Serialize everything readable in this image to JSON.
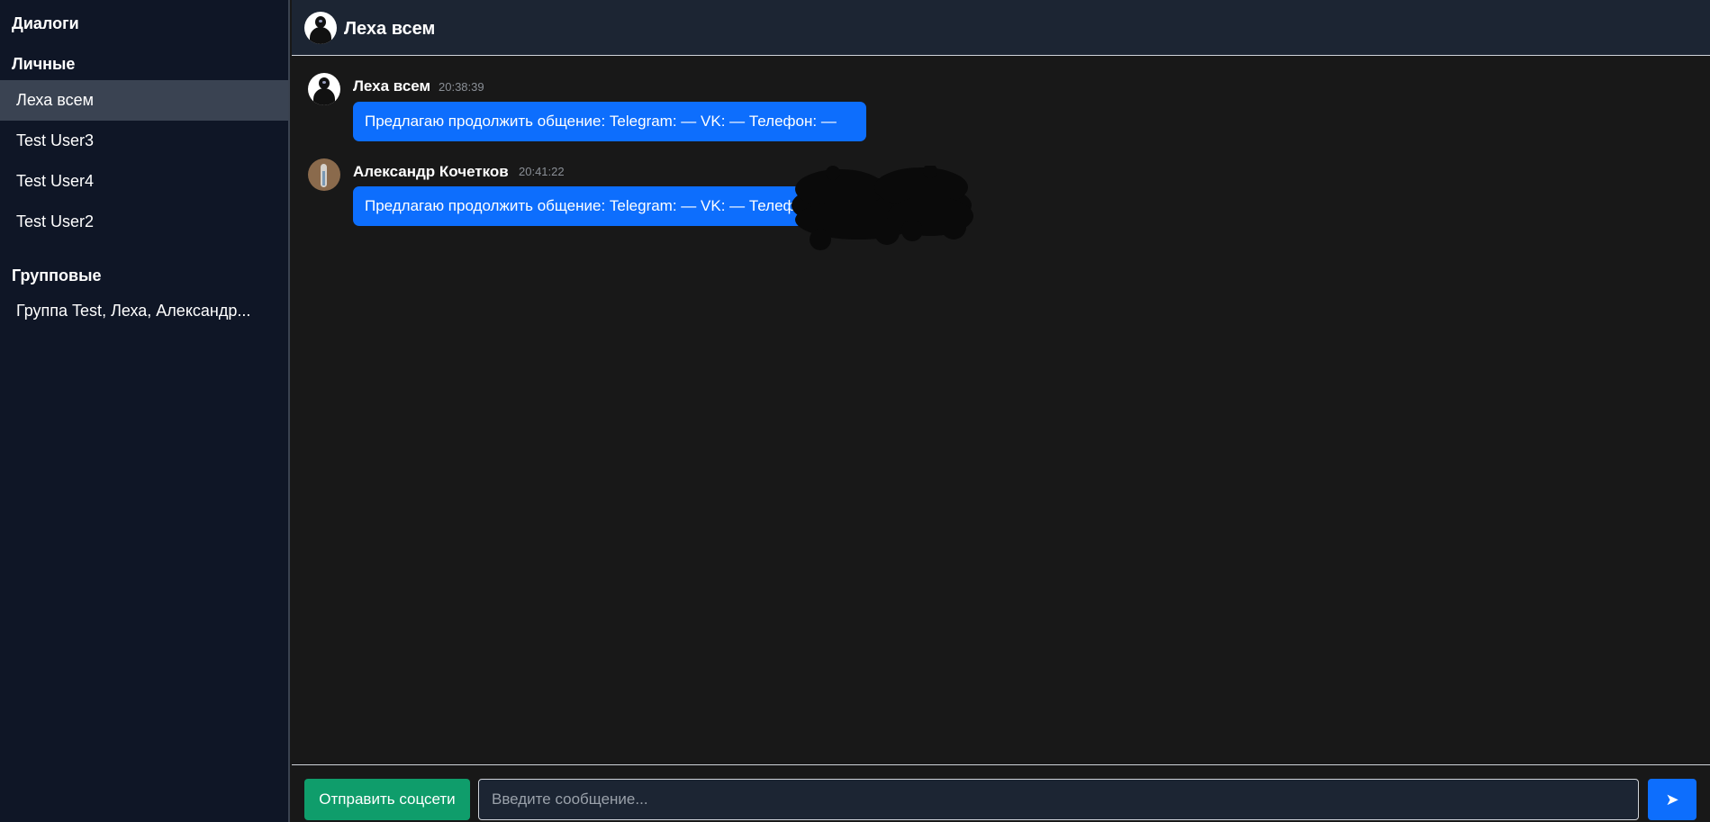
{
  "sidebar": {
    "title": "Диалоги",
    "personal_label": "Личные",
    "personal": [
      {
        "label": "Леха всем"
      },
      {
        "label": "Test User3"
      },
      {
        "label": "Test User4"
      },
      {
        "label": "Test User2"
      }
    ],
    "group_label": "Групповые",
    "groups": [
      {
        "label": "Группа Test, Леха, Александр..."
      }
    ]
  },
  "header": {
    "title": "Леха всем"
  },
  "messages": [
    {
      "author": "Леха всем",
      "time": "20:38:39",
      "text": "Предлагаю продолжить общение: Telegram: — VK: — Телефон: —"
    },
    {
      "author": "Александр Кочетков",
      "time": "20:41:22",
      "text": "Предлагаю продолжить общение: Telegram: — VK: — Телефон: —"
    }
  ],
  "composer": {
    "social_button": "Отправить соцсети",
    "placeholder": "Введите сообщение...",
    "send_icon": "➤"
  },
  "colors": {
    "sidebar_bg": "#0f1626",
    "active_item": "#3a4352",
    "chat_bg": "#181818",
    "bubble": "#0d6efd",
    "social_button": "#0f9d6b"
  }
}
